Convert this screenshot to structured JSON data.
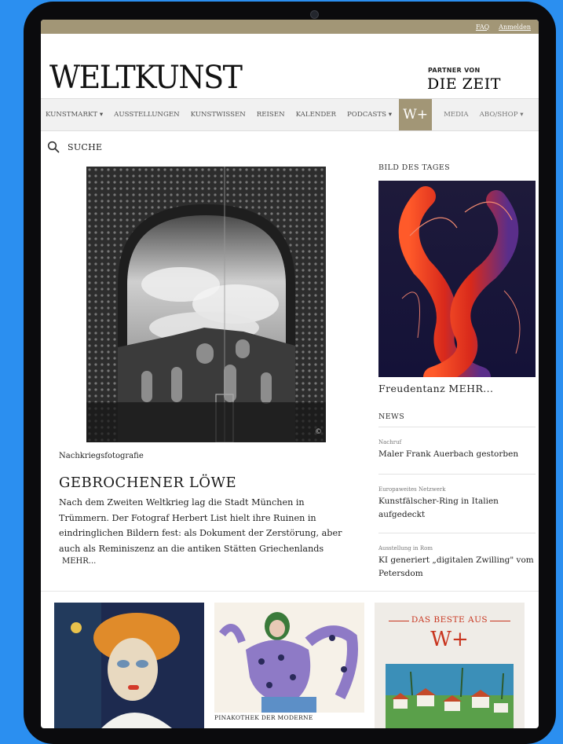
{
  "topbar": {
    "faq": "FAQ",
    "login": "Anmelden"
  },
  "brand": {
    "logo": "WELTKUNST",
    "partner_label": "PARTNER VON",
    "partner_logo": "DIE ZEIT"
  },
  "nav": {
    "items": [
      "KUNSTMARKT ▾",
      "AUSSTELLUNGEN",
      "KUNSTWISSEN",
      "REISEN",
      "KALENDER",
      "PODCASTS ▾"
    ],
    "wplus": "W+",
    "after": [
      "MEDIA",
      "ABO/SHOP ▾"
    ]
  },
  "search": {
    "label": "SUCHE",
    "icon": "search-icon"
  },
  "hero": {
    "kicker": "Nachkriegsfotografie",
    "headline": "GEBROCHENER LÖWE",
    "teaser": "Nach dem Zweiten Weltkrieg lag die Stadt München in Trümmern. Der Fotograf Herbert List hielt ihre Ruinen in eindringlichen Bildern fest: als Dokument der Zerstörung, aber auch als Reminiszenz an die antiken Stätten Griechenlands",
    "more": "MEHR...",
    "image_credit": "©"
  },
  "sidebar": {
    "bild_title": "BILD DES TAGES",
    "bild_caption": "Freudentanz MEHR...",
    "news_title": "NEWS",
    "news": [
      {
        "kicker": "Nachruf",
        "headline": "Maler Frank Auerbach gestorben"
      },
      {
        "kicker": "Europaweites Netzwerk",
        "headline": "Kunstfälscher-Ring in Italien aufgedeckt"
      },
      {
        "kicker": "Ausstellung in Rom",
        "headline": "KI generiert „digitalen Zwilling\" vom Petersdom"
      }
    ]
  },
  "cards": {
    "card2_label": "PINAKOTHEK DER MODERNE",
    "card3_title": "DAS BESTE AUS",
    "card3_logo": "W+"
  },
  "colors": {
    "accent": "#a29676",
    "red": "#c8341e",
    "background": "#2b8ff0"
  }
}
